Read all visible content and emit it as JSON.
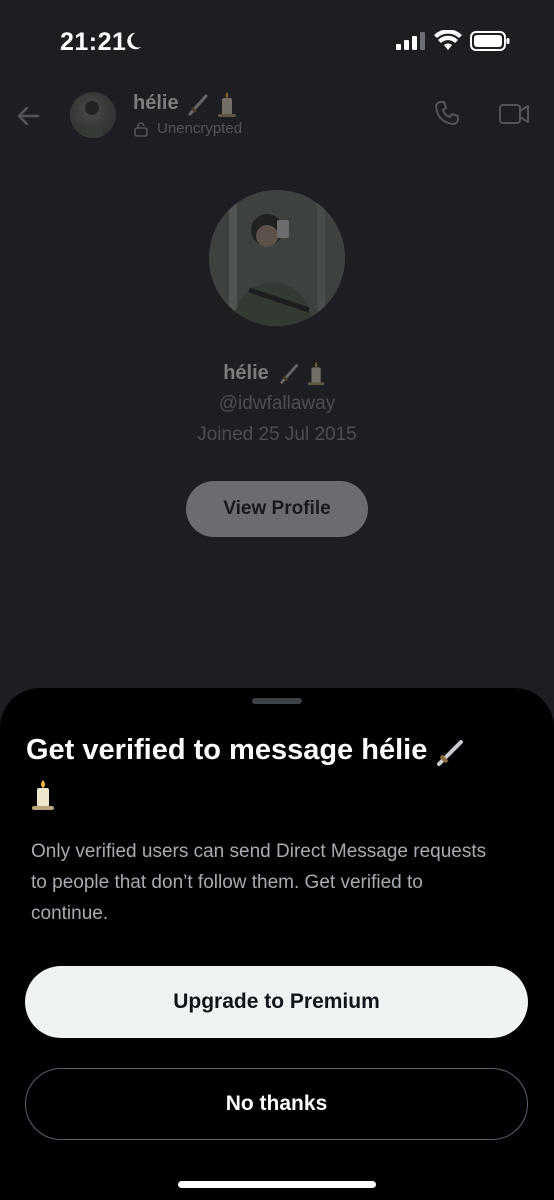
{
  "status_bar": {
    "time": "21:21",
    "icons": [
      "moon-icon",
      "cellular-signal-icon",
      "wifi-icon",
      "battery-icon"
    ]
  },
  "header": {
    "back_icon": "arrow-left-icon",
    "name": "hélie",
    "name_emoji": "🗡️🕯️",
    "encryption_label": "Unencrypted",
    "lock_icon": "lock-icon",
    "actions": [
      "phone-icon",
      "video-camera-icon"
    ]
  },
  "profile": {
    "name": "hélie",
    "name_emoji": "🗡️🕯️",
    "handle": "@idwfallaway",
    "joined": "Joined 25 Jul 2015",
    "view_profile_label": "View Profile"
  },
  "sheet": {
    "title": "Get verified to message hélie",
    "title_emoji": "🗡️🕯️",
    "body": "Only verified users can send Direct Message requests to people that don’t follow them.  Get verified to continue.",
    "primary_button": "Upgrade to Premium",
    "secondary_button": "No thanks"
  },
  "colors": {
    "background": "#1d1e21",
    "sheet": "#000000",
    "primary_button_bg": "#eff3f4",
    "secondary_border": "#536471",
    "body_text": "#a6acb1"
  }
}
